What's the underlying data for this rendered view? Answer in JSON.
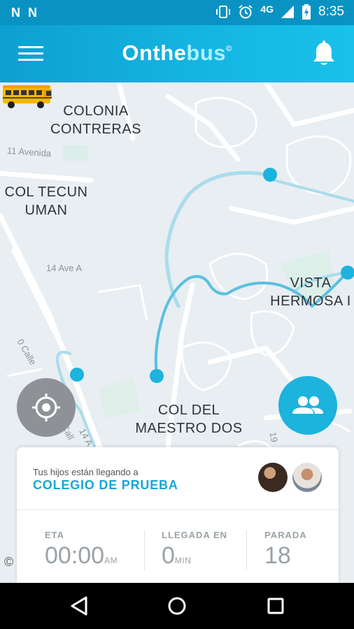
{
  "status_bar": {
    "left_icons": [
      "N",
      "N"
    ],
    "network": "4G",
    "time": "8:35"
  },
  "app_bar": {
    "brand_part1": "Onthe",
    "brand_part2": "bus",
    "brand_mark": "©"
  },
  "map": {
    "labels": {
      "colonia_contreras_1": "COLONIA",
      "colonia_contreras_2": "CONTRERAS",
      "col_tecun_1": "COL TECUN",
      "col_tecun_2": "UMAN",
      "vista_1": "VISTA",
      "vista_2": "HERMOSA I",
      "maestro_1": "COL DEL",
      "maestro_2": "MAESTRO DOS"
    },
    "streets": {
      "avenida_11": "11 Avenida",
      "ave_14a": "14 Ave A",
      "calle_0": "0 Calle",
      "calle_0b": "0 Call",
      "street_14a": "14 A",
      "street_19": "19"
    },
    "attribution": "©"
  },
  "card": {
    "subtitle": "Tus hijos están llegando a",
    "school": "COLEGIO DE PRUEBA",
    "stats": {
      "eta": {
        "label": "ETA",
        "value": "00:00",
        "unit": "AM"
      },
      "arrival": {
        "label": "LLEGADA EN",
        "value": "0",
        "unit": "MIN"
      },
      "stop": {
        "label": "PARADA",
        "value": "18"
      }
    }
  },
  "colors": {
    "status_bar": "#0a93c2",
    "app_bar": "#15b6e2",
    "accent": "#1cb3dd",
    "route": "#5cbfe0",
    "map_bg": "#e8eef2"
  },
  "icons": {
    "menu": "hamburger-menu-icon",
    "bell": "bell-icon",
    "locate": "crosshair-icon",
    "group": "group-icon",
    "bus": "school-bus-icon",
    "back": "triangle-back-icon",
    "home": "circle-home-icon",
    "recents": "square-recents-icon"
  }
}
